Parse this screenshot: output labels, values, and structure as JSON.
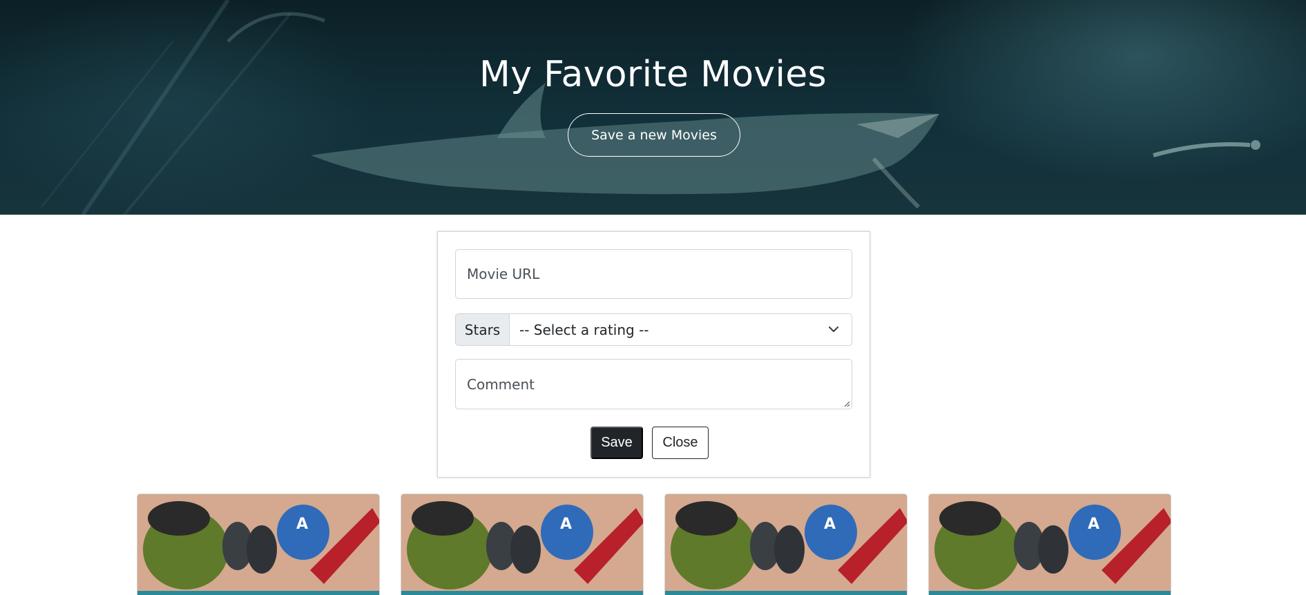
{
  "hero": {
    "title": "My Favorite Movies",
    "save_new_button": "Save a new Movies"
  },
  "form": {
    "url_placeholder": "Movie URL",
    "stars_label": "Stars",
    "rating_selected": "-- Select a rating --",
    "comment_placeholder": "Comment",
    "save_button": "Save",
    "close_button": "Close"
  },
  "cards": [
    {
      "poster": "avengers-poster"
    },
    {
      "poster": "avengers-poster"
    },
    {
      "poster": "avengers-poster"
    },
    {
      "poster": "avengers-poster"
    }
  ],
  "colors": {
    "hero_bg": "#0c2026",
    "dark_button": "#212529",
    "poster_bg": "#d4a98f"
  }
}
